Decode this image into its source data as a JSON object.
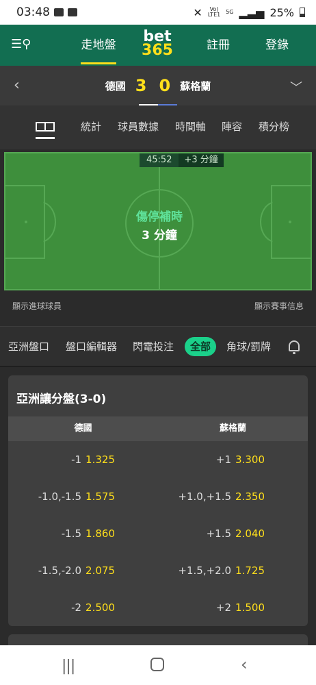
{
  "status_bar": {
    "time": "03:48",
    "network": "5G",
    "battery": "25%"
  },
  "header": {
    "live_label": "走地盤",
    "logo_top": "bet",
    "logo_bottom": "365",
    "register_label": "註冊",
    "login_label": "登錄"
  },
  "match": {
    "home_team": "德國",
    "home_score": "3",
    "away_score": "0",
    "away_team": "蘇格蘭"
  },
  "tabs": [
    "統計",
    "球員數據",
    "時間軸",
    "陣容",
    "積分榜"
  ],
  "pitch": {
    "clock": "45:52",
    "added_time": "+3 分鐘",
    "status_line1": "傷停補時",
    "status_line2": "3 分鐘",
    "show_scorers": "顯示進球球員",
    "show_match_info": "顯示賽事信息"
  },
  "market_tabs": [
    "亞洲盤口",
    "盤口編輯器",
    "閃電投注",
    "全部",
    "角球/罰牌"
  ],
  "active_market_tab": "全部",
  "asian_handicap": {
    "title": "亞洲讓分盤(3-0)",
    "col_home": "德國",
    "col_away": "蘇格蘭",
    "rows": [
      {
        "home_line": "-1",
        "home_odds": "1.325",
        "away_line": "+1",
        "away_odds": "3.300"
      },
      {
        "home_line": "-1.0,-1.5",
        "home_odds": "1.575",
        "away_line": "+1.0,+1.5",
        "away_odds": "2.350"
      },
      {
        "home_line": "-1.5",
        "home_odds": "1.860",
        "away_line": "+1.5",
        "away_odds": "2.040"
      },
      {
        "home_line": "-1.5,-2.0",
        "home_odds": "2.075",
        "away_line": "+1.5,+2.0",
        "away_odds": "1.725"
      },
      {
        "home_line": "-2",
        "home_odds": "2.500",
        "away_line": "+2",
        "away_odds": "1.500"
      }
    ]
  },
  "colors": {
    "brand_green": "#126e51",
    "accent_yellow": "#ffdf1b",
    "active_tab": "#1bd08a"
  }
}
